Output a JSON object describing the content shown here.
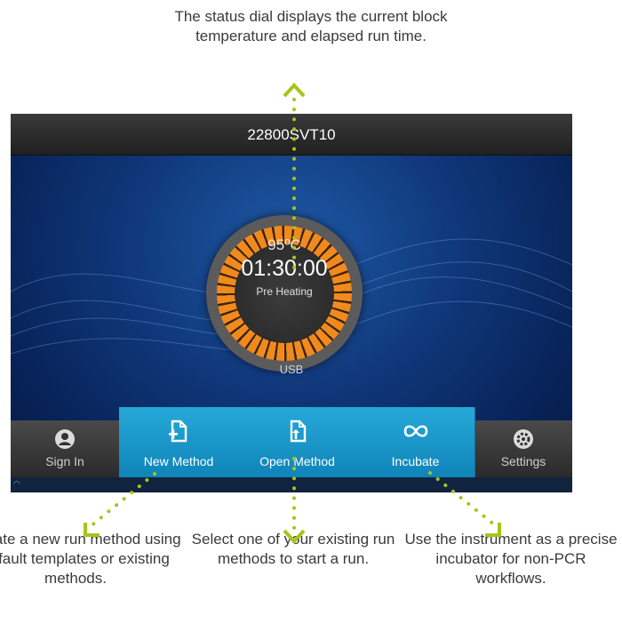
{
  "callouts": {
    "top": "The status dial displays the current block temperature and elapsed run time.",
    "left": "Create a new run method using default templates or existing methods.",
    "middle": "Select one of your existing run methods to start a run.",
    "right": "Use the instrument as a precise incubator for non-PCR workflows."
  },
  "screen": {
    "title": "22800SVT10",
    "dial": {
      "temperature": "95ºC",
      "time": "01:30:00",
      "status": "Pre Heating"
    },
    "usb_label": "USB",
    "nav": [
      {
        "label": "Sign In",
        "icon": "user-icon"
      },
      {
        "label": "New Method",
        "icon": "new-file-icon"
      },
      {
        "label": "Open Method",
        "icon": "open-file-icon"
      },
      {
        "label": "Incubate",
        "icon": "infinity-icon"
      },
      {
        "label": "Settings",
        "icon": "gear-icon"
      }
    ]
  },
  "colors": {
    "accent_blue": "#1a9ccf",
    "dial_orange": "#f18a1c",
    "callout_green": "#a8c41a"
  }
}
